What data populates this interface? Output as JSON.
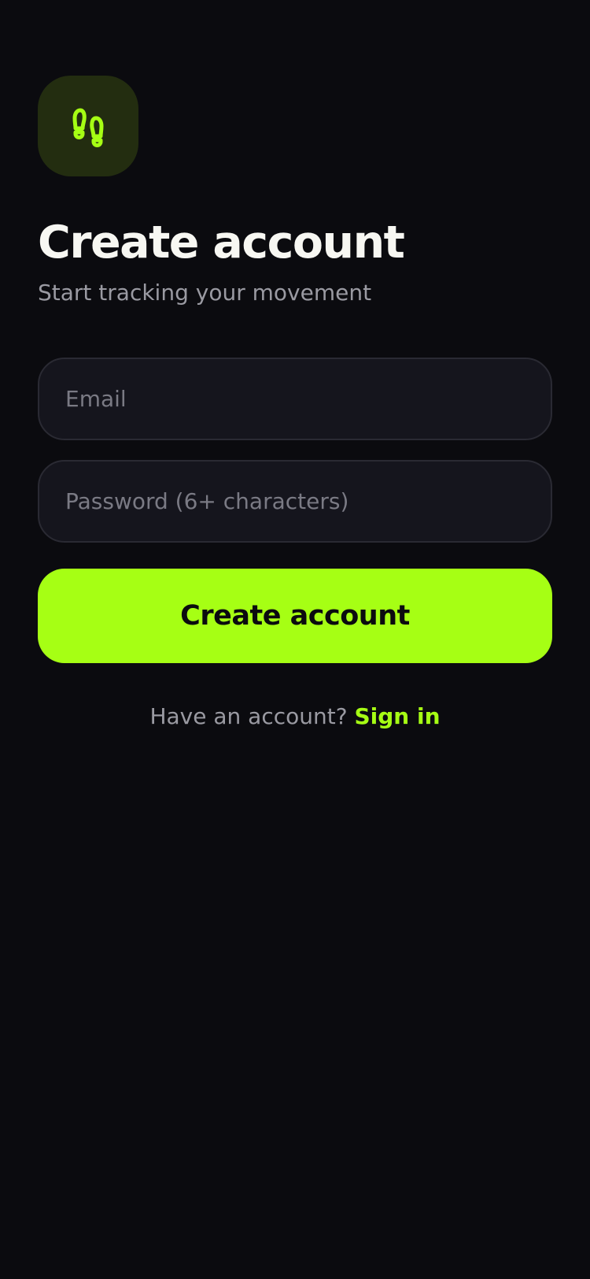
{
  "app": {
    "icon": "footprints-icon",
    "accent_color": "#a6ff14",
    "background_color": "#0b0b0f"
  },
  "header": {
    "title": "Create account",
    "subtitle": "Start tracking your movement"
  },
  "form": {
    "email": {
      "value": "",
      "placeholder": "Email"
    },
    "password": {
      "value": "",
      "placeholder": "Password (6+ characters)"
    },
    "submit_label": "Create account"
  },
  "footer": {
    "prompt": "Have an account?",
    "link_label": "Sign in"
  }
}
